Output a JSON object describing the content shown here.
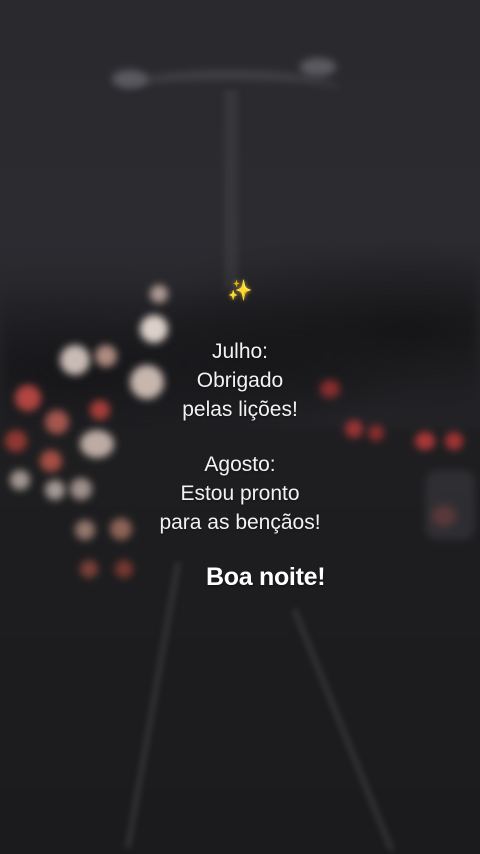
{
  "message": {
    "sparkle_icon": "✨",
    "july_heading": "Julho:",
    "july_line1": "Obrigado",
    "july_line2": "pelas lições!",
    "august_heading": "Agosto:",
    "august_line1": "Estou pronto",
    "august_line2": "para as bençãos!",
    "signoff": "Boa noite!"
  },
  "colors": {
    "text": "#f2f2f2",
    "sparkle": "#ffd84d",
    "tail_light_red": "#d83a3a",
    "headlight_warm": "#f0d6c8"
  }
}
